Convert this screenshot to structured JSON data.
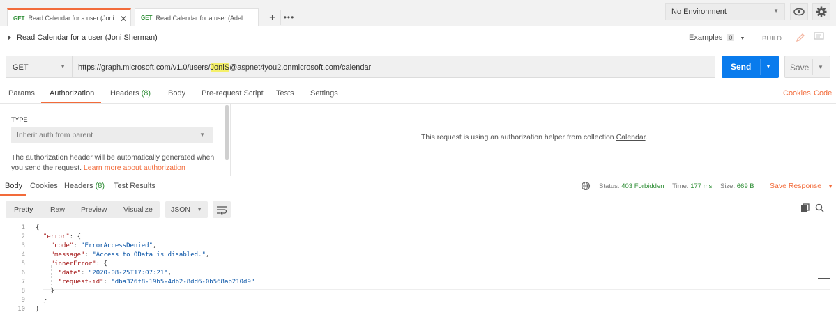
{
  "tabs": [
    {
      "method": "GET",
      "label": "Read Calendar for a user (Joni ...",
      "active": true
    },
    {
      "method": "GET",
      "label": "Read Calendar for a user (Adel...",
      "active": false
    }
  ],
  "environment": {
    "selected": "No Environment"
  },
  "request": {
    "title": "Read Calendar for a user (Joni Sherman)",
    "examples_label": "Examples",
    "examples_count": "0",
    "build_label": "BUILD",
    "method": "GET",
    "url_prefix": "https://graph.microsoft.com/v1.0/users/",
    "url_highlight": "JoniS",
    "url_suffix": "@aspnet4you2.onmicrosoft.com/calendar",
    "send_label": "Send",
    "save_label": "Save"
  },
  "request_tabs": {
    "params": "Params",
    "authorization": "Authorization",
    "headers": "Headers",
    "headers_count": "(8)",
    "body": "Body",
    "pre_request": "Pre-request Script",
    "tests": "Tests",
    "settings": "Settings",
    "cookies": "Cookies",
    "code": "Code"
  },
  "auth": {
    "type_label": "TYPE",
    "type_value": "Inherit auth from parent",
    "description": "The authorization header will be automatically generated when you send the request.",
    "learn_more": "Learn more about authorization",
    "helper_text": "This request is using an authorization helper from collection",
    "collection_link": "Calendar",
    "helper_end": "."
  },
  "response_tabs": {
    "body": "Body",
    "cookies": "Cookies",
    "headers": "Headers",
    "headers_count": "(8)",
    "test_results": "Test Results"
  },
  "response_status": {
    "status_label": "Status:",
    "status_value": "403 Forbidden",
    "time_label": "Time:",
    "time_value": "177 ms",
    "size_label": "Size:",
    "size_value": "669 B",
    "save_response": "Save Response"
  },
  "response_format": {
    "pretty": "Pretty",
    "raw": "Raw",
    "preview": "Preview",
    "visualize": "Visualize",
    "language": "JSON"
  },
  "response_body": [
    {
      "n": "1",
      "t": "{"
    },
    {
      "n": "2",
      "t": "  \"error\": {"
    },
    {
      "n": "3",
      "t": "    \"code\": \"ErrorAccessDenied\","
    },
    {
      "n": "4",
      "t": "    \"message\": \"Access to OData is disabled.\","
    },
    {
      "n": "5",
      "t": "    \"innerError\": {"
    },
    {
      "n": "6",
      "t": "      \"date\": \"2020-08-25T17:07:21\","
    },
    {
      "n": "7",
      "t": "      \"request-id\": \"dba326f8-19b5-4db2-8dd6-0b568ab210d9\""
    },
    {
      "n": "8",
      "t": "    }"
    },
    {
      "n": "9",
      "t": "  }"
    },
    {
      "n": "10",
      "t": "}"
    }
  ],
  "colors": {
    "accent": "#f26b3a",
    "send": "#097bed",
    "status_ok": "#2f8e36",
    "method_get": "#2f8e36"
  }
}
